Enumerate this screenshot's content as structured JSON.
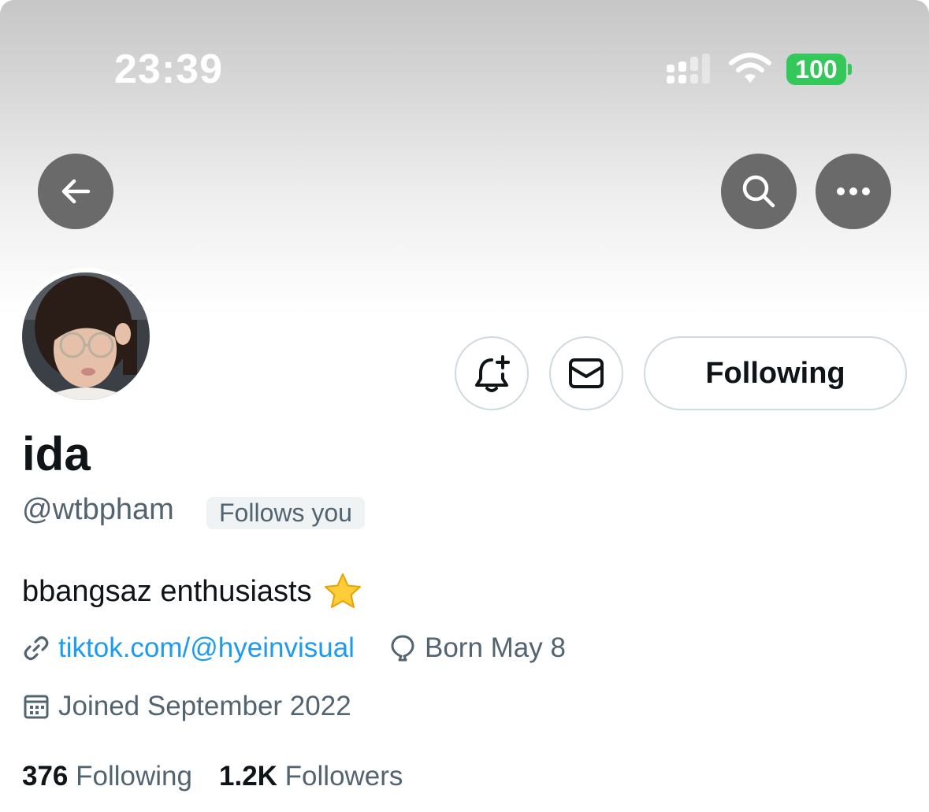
{
  "status_bar": {
    "time": "23:39",
    "battery": "100",
    "icons": [
      "signal-icon",
      "wifi-icon",
      "battery-icon"
    ]
  },
  "nav": {
    "icons": [
      "back-arrow-icon",
      "search-icon",
      "more-icon"
    ]
  },
  "profile": {
    "display_name": "ida",
    "handle": "@wtbpham",
    "follows_you": "Follows you",
    "bio": "bbangsaz enthusiasts",
    "bio_emoji": "star-emoji",
    "link": "tiktok.com/@hyeinvisual",
    "born": "Born May 8",
    "joined": "Joined September 2022"
  },
  "actions": {
    "following_label": "Following",
    "icons": [
      "bell-plus-icon",
      "envelope-icon"
    ]
  },
  "stats": {
    "following_count": "376",
    "following_label": "Following",
    "followers_count": "1.2K",
    "followers_label": "Followers"
  },
  "colors": {
    "accent_link": "#1d9bf0",
    "secondary_text": "#536471",
    "battery_green": "#34c759",
    "nav_circle": "#6a6a6a"
  }
}
